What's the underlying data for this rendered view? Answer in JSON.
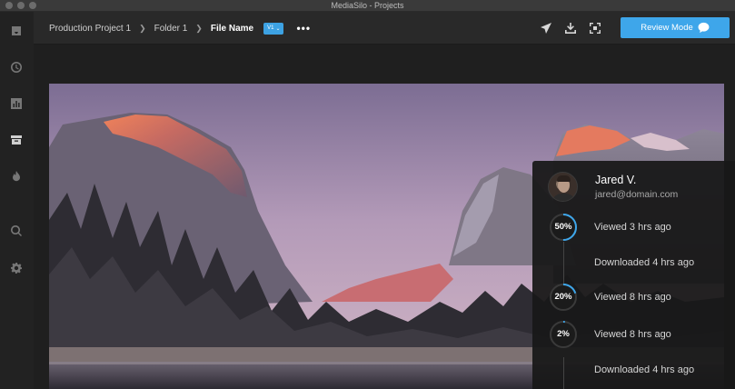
{
  "window": {
    "title": "MediaSilo  -  Projects"
  },
  "sidebar": {
    "items": [
      {
        "name": "inbox-icon"
      },
      {
        "name": "clock-icon"
      },
      {
        "name": "chart-icon"
      },
      {
        "name": "archive-icon",
        "active": true
      },
      {
        "name": "flame-icon"
      },
      {
        "name": "search-icon"
      },
      {
        "name": "gear-icon"
      }
    ]
  },
  "breadcrumb": {
    "items": [
      "Production Project 1",
      "Folder 1"
    ],
    "current": "File Name"
  },
  "version": {
    "label": "V1"
  },
  "toolbar": {
    "more_label": "•••",
    "review_mode_label": "Review Mode"
  },
  "activity": {
    "user_name": "Jared V.",
    "user_email": "jared@domain.com",
    "events": [
      {
        "progress": "50%",
        "progress_value": 0.5,
        "text": "Viewed 3 hrs ago"
      },
      {
        "progress": "",
        "text": "Downloaded 4 hrs ago"
      },
      {
        "progress": "20%",
        "progress_value": 0.2,
        "text": "Viewed 8 hrs ago"
      },
      {
        "progress": "2%",
        "progress_value": 0.02,
        "text": "Viewed 8 hrs ago"
      },
      {
        "progress": "",
        "text": "Downloaded 4 hrs ago"
      }
    ]
  },
  "colors": {
    "accent": "#3ea6ea",
    "background": "#1e1e1e",
    "topbar": "#292929",
    "panel": "#181818"
  }
}
